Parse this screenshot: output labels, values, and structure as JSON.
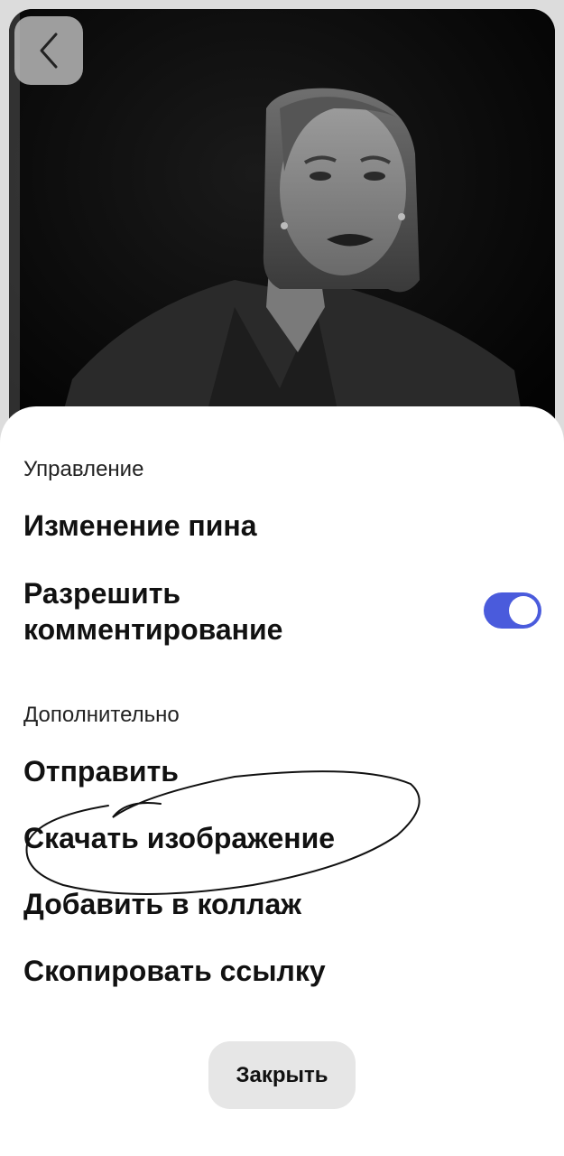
{
  "header": {
    "back_icon": "chevron-left-icon"
  },
  "sheet": {
    "sections": [
      {
        "label": "Управление",
        "items": [
          {
            "label": "Изменение пина"
          },
          {
            "label_line1": "Разрешить",
            "label_line2": "комментирование",
            "toggle_on": true
          }
        ]
      },
      {
        "label": "Дополнительно",
        "items": [
          {
            "label": "Отправить"
          },
          {
            "label": "Скачать изображение"
          },
          {
            "label": "Добавить в коллаж"
          },
          {
            "label": "Скопировать ссылку"
          }
        ]
      }
    ],
    "close_label": "Закрыть"
  },
  "colors": {
    "accent": "#4a5bdc",
    "close_button_bg": "#e6e6e6"
  }
}
